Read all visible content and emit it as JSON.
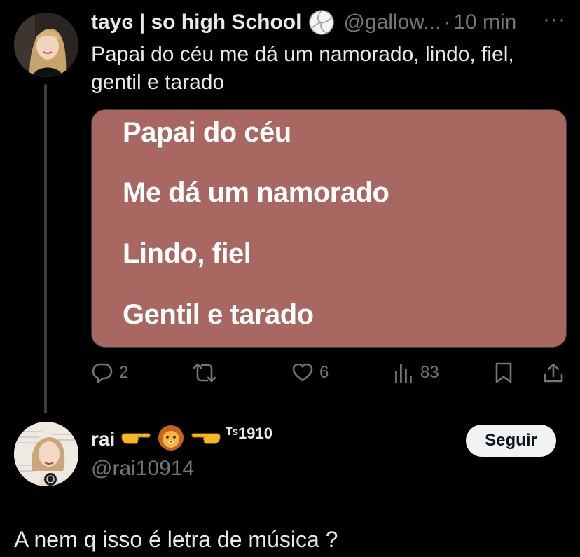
{
  "tweet": {
    "display_name": "tayɞ | so high School",
    "handle": "@gallow...",
    "separator": "·",
    "time": "10 min",
    "more_icon": "more-dots-icon",
    "text": "Papai do céu me dá um namorado, lindo, fiel, gentil e tarado",
    "media_lines": [
      "Papai do céu",
      "Me dá um namorado",
      "Lindo, fiel",
      "Gentil e tarado"
    ],
    "media_bg_color": "#a86760",
    "actions": {
      "reply_count": "2",
      "retweet_count": "",
      "like_count": "6",
      "views_count": "83"
    }
  },
  "reply": {
    "display_name": "rai",
    "emoji_icons": [
      "pointing-right-icon",
      "lion-icon",
      "pointing-left-icon"
    ],
    "tag": "ᵀˢ1910",
    "handle": "@rai10914",
    "follow_label": "Seguir",
    "text": "A nem q isso é letra de música ?"
  },
  "colors": {
    "background": "#000000",
    "text_primary": "#e7e9ea",
    "text_secondary": "#71767b",
    "follow_bg": "#eff3f4"
  }
}
